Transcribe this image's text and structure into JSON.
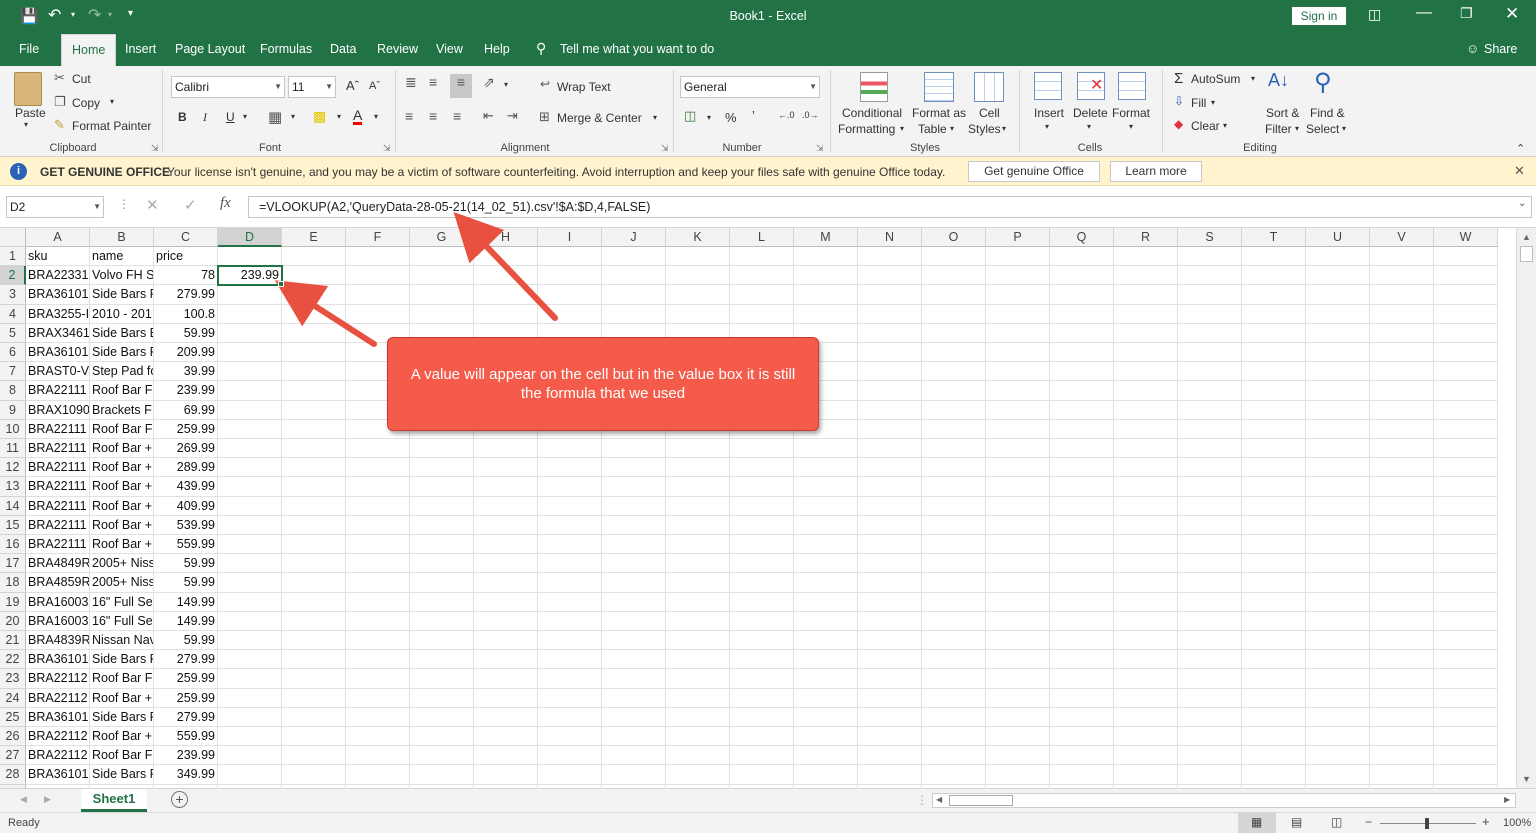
{
  "window": {
    "title": "Book1  -  Excel",
    "sign_in": "Sign in",
    "share": "Share"
  },
  "tabs": [
    "File",
    "Home",
    "Insert",
    "Page Layout",
    "Formulas",
    "Data",
    "Review",
    "View",
    "Help"
  ],
  "tell_me": "Tell me what you want to do",
  "ribbon": {
    "clipboard": {
      "paste": "Paste",
      "cut": "Cut",
      "copy": "Copy",
      "format_painter": "Format Painter",
      "label": "Clipboard"
    },
    "font": {
      "name": "Calibri",
      "size": "11",
      "bold": "B",
      "italic": "I",
      "underline": "U",
      "label": "Font"
    },
    "alignment": {
      "wrap_text": "Wrap Text",
      "merge_center": "Merge & Center",
      "label": "Alignment"
    },
    "number": {
      "format": "General",
      "label": "Number"
    },
    "styles": {
      "conditional": "Conditional",
      "conditional2": "Formatting",
      "format_as": "Format as",
      "format_as2": "Table",
      "cell": "Cell",
      "cell2": "Styles",
      "label": "Styles"
    },
    "cells": {
      "insert": "Insert",
      "delete": "Delete",
      "format": "Format",
      "label": "Cells"
    },
    "editing": {
      "autosum": "AutoSum",
      "fill": "Fill",
      "clear": "Clear",
      "sort": "Sort &",
      "sort2": "Filter",
      "find": "Find &",
      "find2": "Select",
      "label": "Editing"
    }
  },
  "message_bar": {
    "title": "GET GENUINE OFFICE",
    "text": "Your license isn't genuine, and you may be a victim of software counterfeiting. Avoid interruption and keep your files safe with genuine Office today.",
    "button1": "Get genuine Office",
    "button2": "Learn more"
  },
  "formula_bar": {
    "name_box": "D2",
    "formula": "=VLOOKUP(A2,'QueryData-28-05-21(14_02_51).csv'!$A:$D,4,FALSE)"
  },
  "columns": [
    "A",
    "B",
    "C",
    "D",
    "E",
    "F",
    "G",
    "H",
    "I",
    "J",
    "K",
    "L",
    "M",
    "N",
    "O",
    "P",
    "Q",
    "R",
    "S",
    "T",
    "U",
    "V",
    "W"
  ],
  "header_row": [
    "sku",
    "name",
    "price"
  ],
  "rows": [
    [
      "BRA22331",
      "Volvo FH S",
      "78",
      "239.99"
    ],
    [
      "BRA36101",
      "Side Bars F",
      "279.99",
      ""
    ],
    [
      "BRA3255-I",
      "2010 - 201",
      "100.8",
      ""
    ],
    [
      "BRAX3461",
      "Side Bars E",
      "59.99",
      ""
    ],
    [
      "BRA36101",
      "Side Bars F",
      "209.99",
      ""
    ],
    [
      "BRAST0-V(",
      "Step Pad fo",
      "39.99",
      ""
    ],
    [
      "BRA22111",
      "Roof Bar F",
      "239.99",
      ""
    ],
    [
      "BRAX1090",
      "Brackets F",
      "69.99",
      ""
    ],
    [
      "BRA22111",
      "Roof Bar F",
      "259.99",
      ""
    ],
    [
      "BRA22111",
      "Roof Bar +",
      "269.99",
      ""
    ],
    [
      "BRA22111",
      "Roof Bar +",
      "289.99",
      ""
    ],
    [
      "BRA22111",
      "Roof Bar +",
      "439.99",
      ""
    ],
    [
      "BRA22111",
      "Roof Bar +",
      "409.99",
      ""
    ],
    [
      "BRA22111",
      "Roof Bar +",
      "539.99",
      ""
    ],
    [
      "BRA22111",
      "Roof Bar +",
      "559.99",
      ""
    ],
    [
      "BRA4849R",
      "2005+ Niss",
      "59.99",
      ""
    ],
    [
      "BRA4859R",
      "2005+ Niss",
      "59.99",
      ""
    ],
    [
      "BRA16003",
      "16\" Full Se",
      "149.99",
      ""
    ],
    [
      "BRA16003",
      "16\" Full Se",
      "149.99",
      ""
    ],
    [
      "BRA4839R",
      "Nissan Nav",
      "59.99",
      ""
    ],
    [
      "BRA36101",
      "Side Bars F",
      "279.99",
      ""
    ],
    [
      "BRA22112",
      "Roof Bar F",
      "259.99",
      ""
    ],
    [
      "BRA22112",
      "Roof Bar +",
      "259.99",
      ""
    ],
    [
      "BRA36101",
      "Side Bars F",
      "279.99",
      ""
    ],
    [
      "BRA22112",
      "Roof Bar +",
      "559.99",
      ""
    ],
    [
      "BRA22112",
      "Roof Bar F",
      "239.99",
      ""
    ],
    [
      "BRA36101",
      "Side Bars F",
      "349.99",
      ""
    ]
  ],
  "sheet_tab": "Sheet1",
  "status": {
    "ready": "Ready",
    "zoom": "100%"
  },
  "callout": "A value will appear on the cell but in the value box it is still the formula that we used",
  "colors": {
    "excel_green": "#217346",
    "callout_red": "#f45b4b",
    "arrow_red": "#e8503f",
    "message_yellow": "#fff4ce"
  }
}
